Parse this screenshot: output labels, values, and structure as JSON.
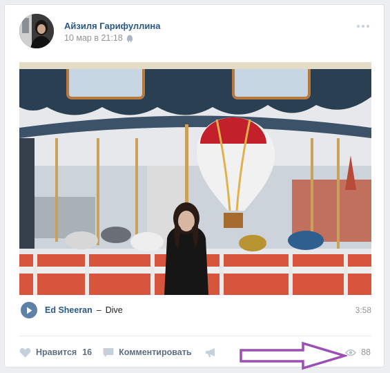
{
  "post": {
    "author": "Айзиля Гарифуллина",
    "date": "10 мар в 21:18"
  },
  "audio": {
    "artist": "Ed Sheeran",
    "separator": "–",
    "title": "Dive",
    "duration": "3:58"
  },
  "actions": {
    "like_label": "Нравится",
    "like_count": "16",
    "comment_label": "Комментировать",
    "views_count": "88"
  },
  "colors": {
    "link": "#2a5885",
    "action": "#5d6e7e",
    "muted": "#939393",
    "play_button": "#5e81a8",
    "annotation_arrow": "#9b4fb4"
  },
  "icons": {
    "device": "android-icon",
    "more": "more-dots-icon",
    "play": "play-icon",
    "like": "heart-icon",
    "comment": "comment-icon",
    "share": "megaphone-icon",
    "views": "eye-icon"
  }
}
